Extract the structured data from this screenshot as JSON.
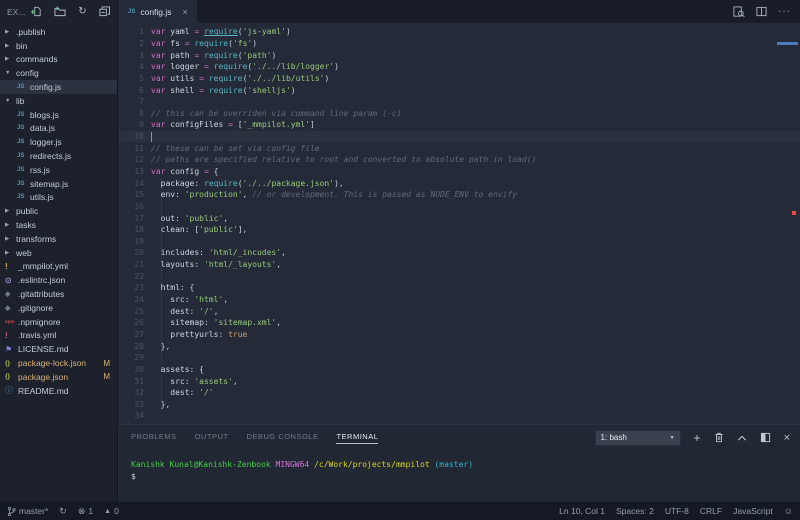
{
  "explorer": {
    "title": "EX...",
    "items": [
      {
        "label": ".publish",
        "kind": "folder",
        "arrow": "closed",
        "indent": 0
      },
      {
        "label": "bin",
        "kind": "folder",
        "arrow": "closed",
        "indent": 0
      },
      {
        "label": "commands",
        "kind": "folder",
        "arrow": "closed",
        "indent": 0
      },
      {
        "label": "config",
        "kind": "folder",
        "arrow": "open",
        "indent": 0
      },
      {
        "label": "config.js",
        "kind": "file",
        "icon": "js",
        "indent": 1,
        "selected": true
      },
      {
        "label": "lib",
        "kind": "folder",
        "arrow": "open",
        "indent": 0
      },
      {
        "label": "blogs.js",
        "kind": "file",
        "icon": "js",
        "indent": 1
      },
      {
        "label": "data.js",
        "kind": "file",
        "icon": "js",
        "indent": 1
      },
      {
        "label": "logger.js",
        "kind": "file",
        "icon": "js",
        "indent": 1
      },
      {
        "label": "redirects.js",
        "kind": "file",
        "icon": "js",
        "indent": 1
      },
      {
        "label": "rss.js",
        "kind": "file",
        "icon": "js",
        "indent": 1
      },
      {
        "label": "sitemap.js",
        "kind": "file",
        "icon": "js",
        "indent": 1
      },
      {
        "label": "utils.js",
        "kind": "file",
        "icon": "js",
        "indent": 1
      },
      {
        "label": "public",
        "kind": "folder",
        "arrow": "closed",
        "indent": 0
      },
      {
        "label": "tasks",
        "kind": "folder",
        "arrow": "closed",
        "indent": 0
      },
      {
        "label": "transforms",
        "kind": "folder",
        "arrow": "closed",
        "indent": 0
      },
      {
        "label": "web",
        "kind": "folder",
        "arrow": "closed",
        "indent": 0
      },
      {
        "label": "_mmpilot.yml",
        "kind": "file",
        "icon": "excl-y",
        "indent": 0
      },
      {
        "label": ".eslintrc.json",
        "kind": "file",
        "icon": "eslint",
        "indent": 0
      },
      {
        "label": ".gitattributes",
        "kind": "file",
        "icon": "git",
        "indent": 0
      },
      {
        "label": ".gitignore",
        "kind": "file",
        "icon": "git",
        "indent": 0
      },
      {
        "label": ".npmignore",
        "kind": "file",
        "icon": "npm",
        "indent": 0
      },
      {
        "label": ".travis.yml",
        "kind": "file",
        "icon": "excl-r",
        "indent": 0
      },
      {
        "label": "LICENSE.md",
        "kind": "file",
        "icon": "license",
        "indent": 0
      },
      {
        "label": "package-lock.json",
        "kind": "file",
        "icon": "json",
        "indent": 0,
        "badge": "M",
        "modified": true
      },
      {
        "label": "package.json",
        "kind": "file",
        "icon": "json",
        "indent": 0,
        "badge": "M",
        "modified": true
      },
      {
        "label": "README.md",
        "kind": "file",
        "icon": "info",
        "indent": 0
      }
    ]
  },
  "icon_glyphs": {
    "js": "JS",
    "excl-y": "!",
    "excl-r": "!",
    "eslint": "⊙",
    "git": "◆",
    "npm": "npm",
    "license": "⚑",
    "json": "{}",
    "info": "ⓘ",
    "arrow_closed": "▶",
    "arrow_open": "▼",
    "refresh": "↻",
    "sync": "↻",
    "error": "⊗",
    "warning": "▲",
    "smiley": "☺",
    "close": "×",
    "caret_down": "▼",
    "plus": "+"
  },
  "tabbar": {
    "tab": {
      "label": "config.js",
      "file_icon": "JS",
      "close": "×"
    },
    "more_actions": "···"
  },
  "editor": {
    "cursor_line": 10,
    "lines": [
      {
        "n": 1,
        "t": [
          [
            "kw",
            "var"
          ],
          [
            "pl",
            " "
          ],
          [
            "id",
            "yaml"
          ],
          [
            "pl",
            " "
          ],
          [
            "op",
            "="
          ],
          [
            "pl",
            " "
          ],
          [
            "fnu",
            "require"
          ],
          [
            "pl",
            "("
          ],
          [
            "str",
            "'js-yaml'"
          ],
          [
            "pl",
            ")"
          ]
        ]
      },
      {
        "n": 2,
        "t": [
          [
            "kw",
            "var"
          ],
          [
            "pl",
            " "
          ],
          [
            "id",
            "fs"
          ],
          [
            "pl",
            " "
          ],
          [
            "op",
            "="
          ],
          [
            "pl",
            " "
          ],
          [
            "fn",
            "require"
          ],
          [
            "pl",
            "("
          ],
          [
            "str",
            "'fs'"
          ],
          [
            "pl",
            ")"
          ]
        ]
      },
      {
        "n": 3,
        "t": [
          [
            "kw",
            "var"
          ],
          [
            "pl",
            " "
          ],
          [
            "id",
            "path"
          ],
          [
            "pl",
            " "
          ],
          [
            "op",
            "="
          ],
          [
            "pl",
            " "
          ],
          [
            "fn",
            "require"
          ],
          [
            "pl",
            "("
          ],
          [
            "str",
            "'path'"
          ],
          [
            "pl",
            ")"
          ]
        ]
      },
      {
        "n": 4,
        "t": [
          [
            "kw",
            "var"
          ],
          [
            "pl",
            " "
          ],
          [
            "id",
            "logger"
          ],
          [
            "pl",
            " "
          ],
          [
            "op",
            "="
          ],
          [
            "pl",
            " "
          ],
          [
            "fn",
            "require"
          ],
          [
            "pl",
            "("
          ],
          [
            "str",
            "'./../lib/logger'"
          ],
          [
            "pl",
            ")"
          ]
        ]
      },
      {
        "n": 5,
        "t": [
          [
            "kw",
            "var"
          ],
          [
            "pl",
            " "
          ],
          [
            "id",
            "utils"
          ],
          [
            "pl",
            " "
          ],
          [
            "op",
            "="
          ],
          [
            "pl",
            " "
          ],
          [
            "fn",
            "require"
          ],
          [
            "pl",
            "("
          ],
          [
            "str",
            "'./../lib/utils'"
          ],
          [
            "pl",
            ")"
          ]
        ]
      },
      {
        "n": 6,
        "t": [
          [
            "kw",
            "var"
          ],
          [
            "pl",
            " "
          ],
          [
            "id",
            "shell"
          ],
          [
            "pl",
            " "
          ],
          [
            "op",
            "="
          ],
          [
            "pl",
            " "
          ],
          [
            "fn",
            "require"
          ],
          [
            "pl",
            "("
          ],
          [
            "str",
            "'shelljs'"
          ],
          [
            "pl",
            ")"
          ]
        ]
      },
      {
        "n": 7,
        "t": []
      },
      {
        "n": 8,
        "t": [
          [
            "cm",
            "// this can be overriden via command line param (-c)"
          ]
        ]
      },
      {
        "n": 9,
        "t": [
          [
            "kw",
            "var"
          ],
          [
            "pl",
            " "
          ],
          [
            "id",
            "configFiles"
          ],
          [
            "pl",
            " "
          ],
          [
            "op",
            "="
          ],
          [
            "pl",
            " ["
          ],
          [
            "str",
            "'_mmpilot.yml'"
          ],
          [
            "pl",
            "]"
          ]
        ]
      },
      {
        "n": 10,
        "t": [
          [
            "cursor",
            ""
          ]
        ]
      },
      {
        "n": 11,
        "t": [
          [
            "cm",
            "// these can be set via config file"
          ]
        ]
      },
      {
        "n": 12,
        "t": [
          [
            "cm",
            "// paths are specified relative to root and converted to absolute path in load()"
          ]
        ]
      },
      {
        "n": 13,
        "t": [
          [
            "kw",
            "var"
          ],
          [
            "pl",
            " "
          ],
          [
            "id",
            "config"
          ],
          [
            "pl",
            " "
          ],
          [
            "op",
            "="
          ],
          [
            "pl",
            " {"
          ]
        ]
      },
      {
        "n": 14,
        "t": [
          [
            "pl",
            "  "
          ],
          [
            "id",
            "package"
          ],
          [
            "pl",
            ": "
          ],
          [
            "fn",
            "require"
          ],
          [
            "pl",
            "("
          ],
          [
            "str",
            "'./../package.json'"
          ],
          [
            "pl",
            "),"
          ]
        ]
      },
      {
        "n": 15,
        "t": [
          [
            "pl",
            "  "
          ],
          [
            "id",
            "env"
          ],
          [
            "pl",
            ": "
          ],
          [
            "str",
            "'production'"
          ],
          [
            "pl",
            ", "
          ],
          [
            "cm",
            "// or development. This is passed as NODE_ENV to envify"
          ]
        ]
      },
      {
        "n": 16,
        "t": []
      },
      {
        "n": 17,
        "t": [
          [
            "pl",
            "  "
          ],
          [
            "id",
            "out"
          ],
          [
            "pl",
            ": "
          ],
          [
            "str",
            "'public'"
          ],
          [
            "pl",
            ","
          ]
        ]
      },
      {
        "n": 18,
        "t": [
          [
            "pl",
            "  "
          ],
          [
            "id",
            "clean"
          ],
          [
            "pl",
            ": ["
          ],
          [
            "str",
            "'public'"
          ],
          [
            "pl",
            "],"
          ]
        ]
      },
      {
        "n": 19,
        "t": []
      },
      {
        "n": 20,
        "t": [
          [
            "pl",
            "  "
          ],
          [
            "id",
            "includes"
          ],
          [
            "pl",
            ": "
          ],
          [
            "str",
            "'html/_incudes'"
          ],
          [
            "pl",
            ","
          ]
        ]
      },
      {
        "n": 21,
        "t": [
          [
            "pl",
            "  "
          ],
          [
            "id",
            "layouts"
          ],
          [
            "pl",
            ": "
          ],
          [
            "str",
            "'html/_layouts'"
          ],
          [
            "pl",
            ","
          ]
        ]
      },
      {
        "n": 22,
        "t": []
      },
      {
        "n": 23,
        "t": [
          [
            "pl",
            "  "
          ],
          [
            "id",
            "html"
          ],
          [
            "pl",
            ": {"
          ]
        ]
      },
      {
        "n": 24,
        "t": [
          [
            "pl",
            "    "
          ],
          [
            "id",
            "src"
          ],
          [
            "pl",
            ": "
          ],
          [
            "str",
            "'html'"
          ],
          [
            "pl",
            ","
          ]
        ]
      },
      {
        "n": 25,
        "t": [
          [
            "pl",
            "    "
          ],
          [
            "id",
            "dest"
          ],
          [
            "pl",
            ": "
          ],
          [
            "str",
            "'/'"
          ],
          [
            "pl",
            ","
          ]
        ]
      },
      {
        "n": 26,
        "t": [
          [
            "pl",
            "    "
          ],
          [
            "id",
            "sitemap"
          ],
          [
            "pl",
            ": "
          ],
          [
            "str",
            "'sitemap.xml'"
          ],
          [
            "pl",
            ","
          ]
        ]
      },
      {
        "n": 27,
        "t": [
          [
            "pl",
            "    "
          ],
          [
            "id",
            "prettyurls"
          ],
          [
            "pl",
            ": "
          ],
          [
            "bool",
            "true"
          ]
        ]
      },
      {
        "n": 28,
        "t": [
          [
            "pl",
            "  },"
          ]
        ]
      },
      {
        "n": 29,
        "t": []
      },
      {
        "n": 30,
        "t": [
          [
            "pl",
            "  "
          ],
          [
            "id",
            "assets"
          ],
          [
            "pl",
            ": {"
          ]
        ]
      },
      {
        "n": 31,
        "t": [
          [
            "pl",
            "    "
          ],
          [
            "id",
            "src"
          ],
          [
            "pl",
            ": "
          ],
          [
            "str",
            "'assets'"
          ],
          [
            "pl",
            ","
          ]
        ]
      },
      {
        "n": 32,
        "t": [
          [
            "pl",
            "    "
          ],
          [
            "id",
            "dest"
          ],
          [
            "pl",
            ": "
          ],
          [
            "str",
            "'/'"
          ]
        ]
      },
      {
        "n": 33,
        "t": [
          [
            "pl",
            "  },"
          ]
        ]
      },
      {
        "n": 34,
        "t": []
      }
    ]
  },
  "panel": {
    "tabs": [
      {
        "label": "PROBLEMS",
        "active": false
      },
      {
        "label": "OUTPUT",
        "active": false
      },
      {
        "label": "DEBUG CONSOLE",
        "active": false
      },
      {
        "label": "TERMINAL",
        "active": true
      }
    ],
    "select_value": "1: bash",
    "terminal_lines": [
      [
        [
          "tg",
          "Kanishk Kunal@Kanishk-Zenbook"
        ],
        [
          "tw",
          " "
        ],
        [
          "tm",
          "MINGW64"
        ],
        [
          "tw",
          " "
        ],
        [
          "ty",
          "/c/Work/projects/mmpilot"
        ],
        [
          "tw",
          " "
        ],
        [
          "tc",
          "(master)"
        ]
      ],
      [
        [
          "tw",
          "$"
        ]
      ]
    ]
  },
  "statusbar": {
    "branch": "master*",
    "errors": "1",
    "warnings": "0",
    "right_items": [
      "Ln 10, Col 1",
      "Spaces: 2",
      "UTF-8",
      "CRLF",
      "JavaScript"
    ]
  },
  "colors": {
    "accent_file_js": "#519aba",
    "modified_file": "#d8b075",
    "error_marker": "#e04b4b",
    "visible_region_marker": "#4a7bbf",
    "keyword": "#cf6fc5",
    "string": "#98c978",
    "function": "#56b6c2",
    "comment": "#5e6a7e",
    "boolean": "#d19a66"
  }
}
